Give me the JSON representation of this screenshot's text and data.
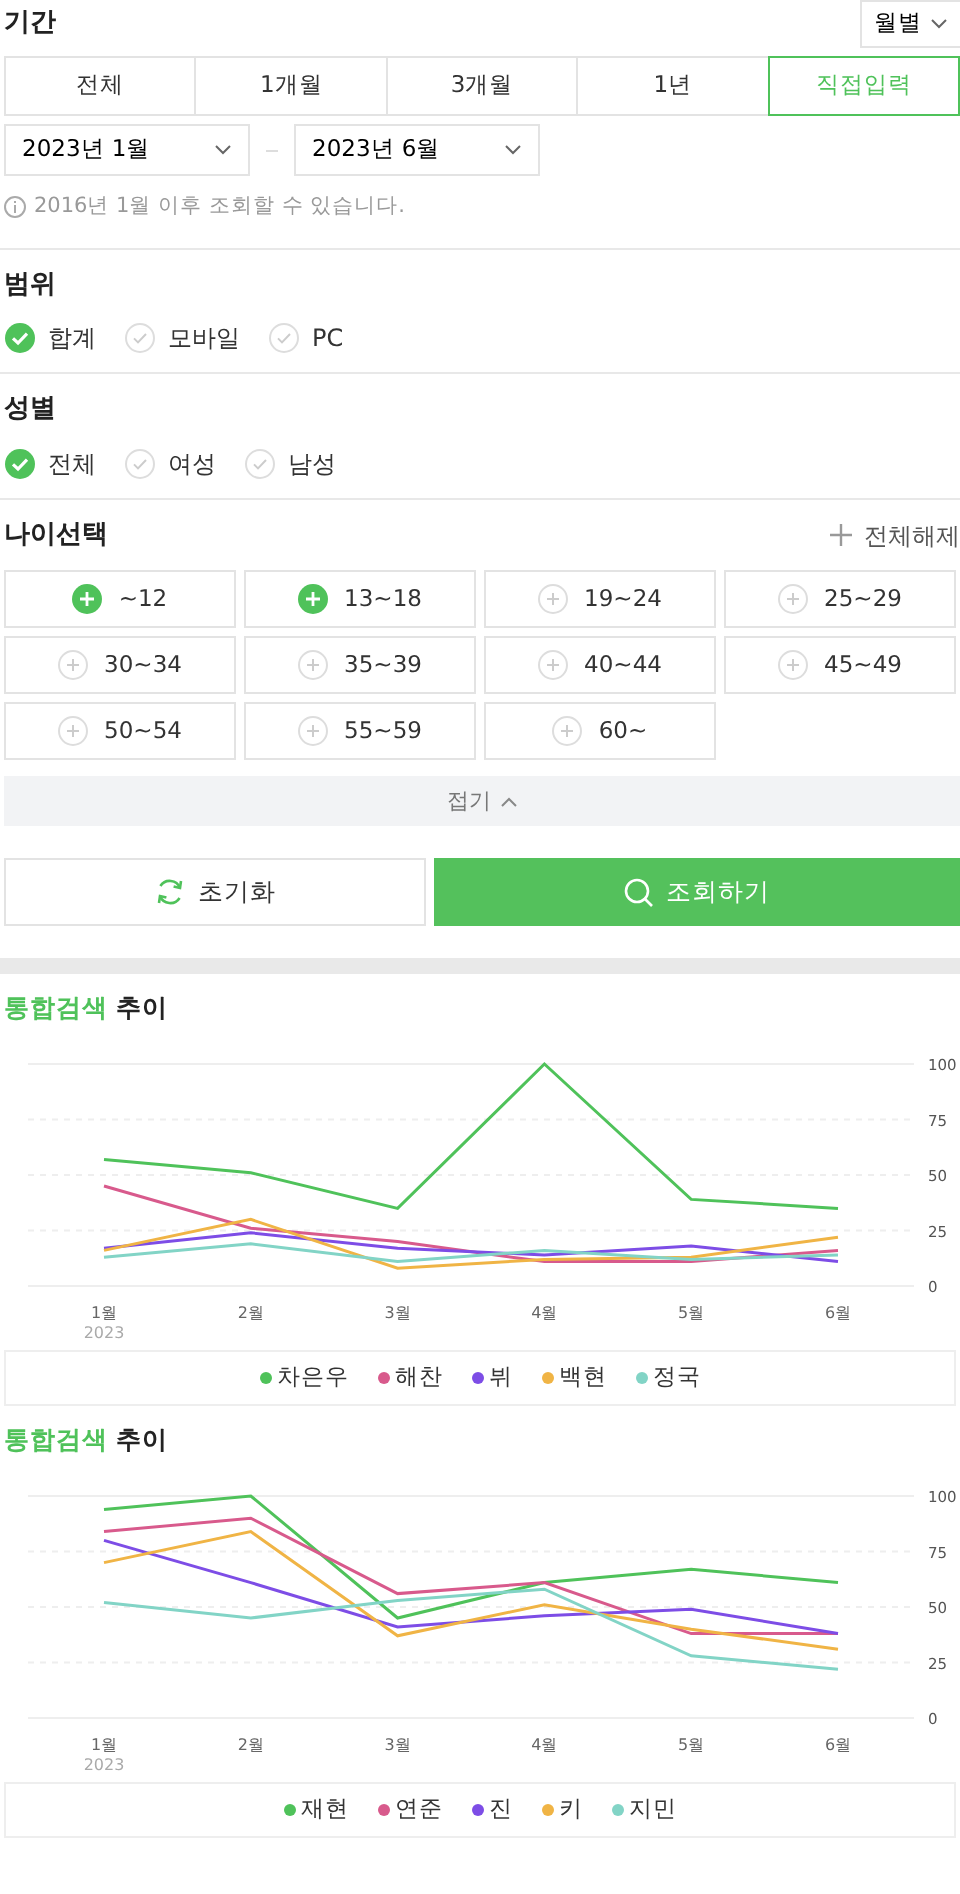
{
  "period": {
    "title": "기간",
    "unit_select": {
      "value": "월별"
    },
    "tabs": [
      {
        "label": "전체",
        "selected": false
      },
      {
        "label": "1개월",
        "selected": false
      },
      {
        "label": "3개월",
        "selected": false
      },
      {
        "label": "1년",
        "selected": false
      },
      {
        "label": "직접입력",
        "selected": true
      }
    ],
    "start": {
      "value": "2023년 1월"
    },
    "end": {
      "value": "2023년 6월"
    },
    "note": "2016년 1월 이후 조회할 수 있습니다."
  },
  "scope": {
    "title": "범위",
    "options": [
      {
        "label": "합계",
        "checked": true
      },
      {
        "label": "모바일",
        "checked": false
      },
      {
        "label": "PC",
        "checked": false
      }
    ]
  },
  "gender": {
    "title": "성별",
    "options": [
      {
        "label": "전체",
        "checked": true
      },
      {
        "label": "여성",
        "checked": false
      },
      {
        "label": "남성",
        "checked": false
      }
    ]
  },
  "age": {
    "title": "나이선택",
    "clear_all": "전체해제",
    "collapse": "접기",
    "options": [
      {
        "label": "~12",
        "selected": true
      },
      {
        "label": "13~18",
        "selected": true
      },
      {
        "label": "19~24",
        "selected": false
      },
      {
        "label": "25~29",
        "selected": false
      },
      {
        "label": "30~34",
        "selected": false
      },
      {
        "label": "35~39",
        "selected": false
      },
      {
        "label": "40~44",
        "selected": false
      },
      {
        "label": "45~49",
        "selected": false
      },
      {
        "label": "50~54",
        "selected": false
      },
      {
        "label": "55~59",
        "selected": false
      },
      {
        "label": "60~",
        "selected": false
      }
    ]
  },
  "buttons": {
    "reset": "초기화",
    "search": "조회하기"
  },
  "charts": [
    {
      "title_highlight": "통합검색",
      "title": "추이",
      "chart_data": {
        "type": "line",
        "grid": true,
        "categories": [
          "1월",
          "2월",
          "3월",
          "4월",
          "5월",
          "6월"
        ],
        "ylim": [
          0,
          100
        ],
        "yticks": [
          0,
          25,
          50,
          75,
          100
        ],
        "annotations": [
          "2023"
        ],
        "series": [
          {
            "name": "차은우",
            "color": "#4fc25a",
            "values": [
              57,
              51,
              35,
              100,
              39,
              35
            ]
          },
          {
            "name": "해찬",
            "color": "#d85a8c",
            "values": [
              45,
              26,
              20,
              11,
              11,
              16
            ]
          },
          {
            "name": "뷔",
            "color": "#7d4de6",
            "values": [
              17,
              24,
              17,
              14,
              18,
              11
            ]
          },
          {
            "name": "백현",
            "color": "#f0b445",
            "values": [
              16,
              30,
              8,
              12,
              13,
              22
            ]
          },
          {
            "name": "정국",
            "color": "#82d4c6",
            "values": [
              13,
              19,
              11,
              16,
              12,
              14
            ]
          }
        ]
      }
    },
    {
      "title_highlight": "통합검색",
      "title": "추이",
      "chart_data": {
        "type": "line",
        "grid": true,
        "categories": [
          "1월",
          "2월",
          "3월",
          "4월",
          "5월",
          "6월"
        ],
        "ylim": [
          0,
          100
        ],
        "yticks": [
          0,
          25,
          50,
          75,
          100
        ],
        "annotations": [
          "2023"
        ],
        "series": [
          {
            "name": "재현",
            "color": "#4fc25a",
            "values": [
              94,
              100,
              45,
              61,
              67,
              61
            ]
          },
          {
            "name": "연준",
            "color": "#d85a8c",
            "values": [
              84,
              90,
              56,
              61,
              38,
              38
            ]
          },
          {
            "name": "진",
            "color": "#7d4de6",
            "values": [
              80,
              61,
              41,
              46,
              49,
              38
            ]
          },
          {
            "name": "키",
            "color": "#f0b445",
            "values": [
              70,
              84,
              37,
              51,
              40,
              31
            ]
          },
          {
            "name": "지민",
            "color": "#82d4c6",
            "values": [
              52,
              45,
              53,
              58,
              28,
              22
            ]
          }
        ]
      }
    }
  ]
}
